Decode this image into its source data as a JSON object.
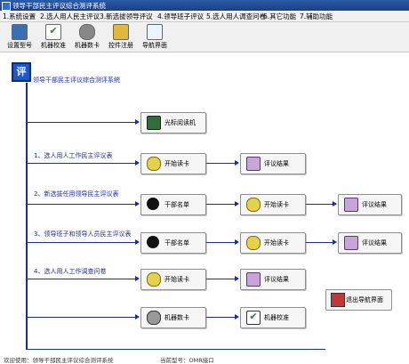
{
  "window": {
    "title": "领导干部民主评议综合测评系统"
  },
  "menu": [
    "1.系统设置",
    "2.选人用人民主评议",
    "3.新选拔领导评议",
    "4.领导班子评议",
    "5.选人用人调查问卷",
    "6.其它功能",
    "7.辅助功能"
  ],
  "toolbar": [
    {
      "label": "设置型号",
      "icon": "settings-model-icon"
    },
    {
      "label": "机器校准",
      "icon": "machine-calibrate-icon"
    },
    {
      "label": "机器数卡",
      "icon": "machine-count-icon"
    },
    {
      "label": "控件注册",
      "icon": "control-register-icon"
    },
    {
      "label": "导航界面",
      "icon": "navigation-icon"
    }
  ],
  "main": {
    "logo_char": "评",
    "system_title": "领导干部民主评议综合测评系统",
    "reader_button": "光标阅读机",
    "sections": [
      {
        "label": "1、选人用人工作民主评议表",
        "buttons": [
          "开始读卡",
          "评议结果"
        ]
      },
      {
        "label": "2、新选拔任用领导民主评议表",
        "buttons": [
          "干部名单",
          "开始读卡",
          "评议结果"
        ]
      },
      {
        "label": "3、领导班子和领导人员民主评议表",
        "buttons": [
          "干部名单",
          "开始读卡",
          "评议结果"
        ]
      },
      {
        "label": "4、选人用人工作调查问卷",
        "buttons": [
          "开始读卡",
          "评议结果"
        ]
      }
    ],
    "machine_buttons": [
      "机器数卡",
      "机器校准"
    ],
    "exit_button": "退出导航界面"
  },
  "status": {
    "left": "欢迎使用：领导干部民主评议综合测评系统",
    "right": "当前型号：OMR接口"
  }
}
